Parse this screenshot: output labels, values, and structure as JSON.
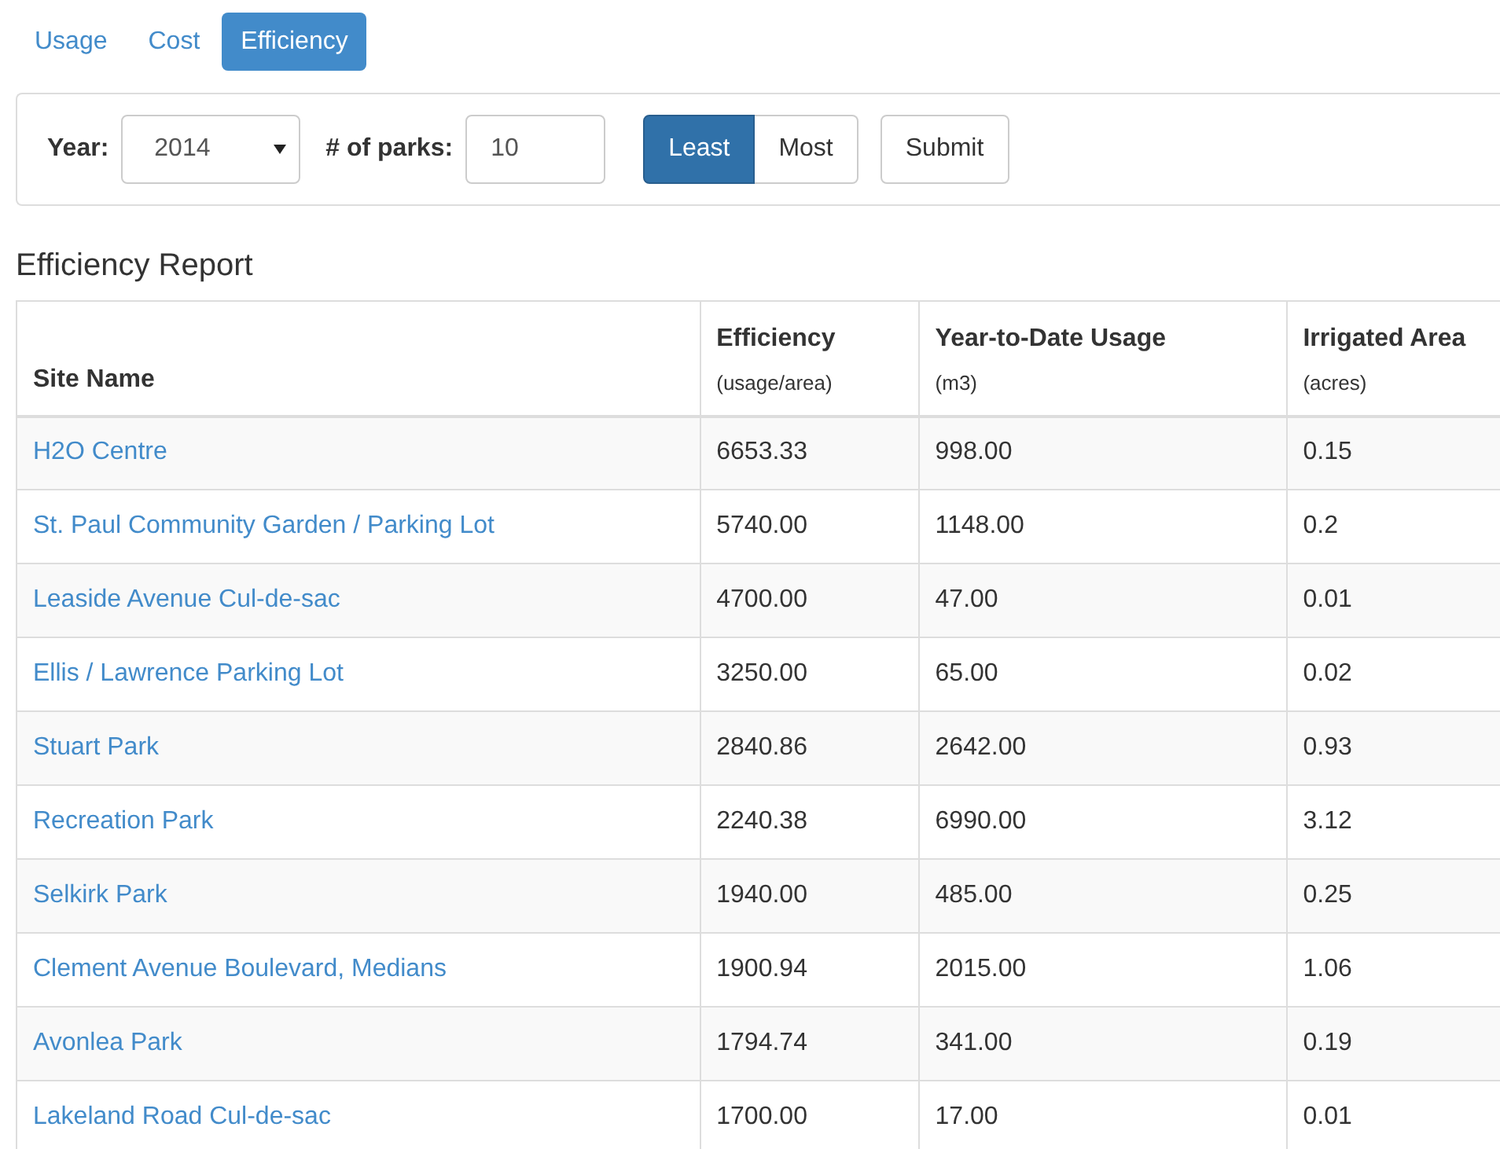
{
  "tabs": [
    {
      "label": "Usage",
      "selected": false
    },
    {
      "label": "Cost",
      "selected": false
    },
    {
      "label": "Efficiency",
      "selected": true
    }
  ],
  "filters": {
    "year_label": "Year:",
    "year": "2014",
    "parks_label": "# of parks:",
    "parks": "10",
    "order": [
      {
        "label": "Least",
        "selected": true
      },
      {
        "label": "Most",
        "selected": false
      }
    ],
    "submit": "Submit"
  },
  "report_title": "Efficiency Report",
  "table": {
    "columns": [
      {
        "label": "Site Name"
      },
      {
        "label": "Efficiency",
        "unit": "(usage/area)"
      },
      {
        "label": "Year-to-Date Usage",
        "unit": "(m3)"
      },
      {
        "label": "Irrigated Area",
        "unit": "(acres)"
      }
    ],
    "rows": [
      [
        "H2O Centre",
        "6653.33",
        "998.00",
        "0.15"
      ],
      [
        "St. Paul Community Garden / Parking Lot",
        "5740.00",
        "1148.00",
        "0.2"
      ],
      [
        "Leaside Avenue Cul-de-sac",
        "4700.00",
        "47.00",
        "0.01"
      ],
      [
        "Ellis / Lawrence Parking Lot",
        "3250.00",
        "65.00",
        "0.02"
      ],
      [
        "Stuart Park",
        "2840.86",
        "2642.00",
        "0.93"
      ],
      [
        "Recreation Park",
        "2240.38",
        "6990.00",
        "3.12"
      ],
      [
        "Selkirk Park",
        "1940.00",
        "485.00",
        "0.25"
      ],
      [
        "Clement Avenue Boulevard, Medians",
        "1900.94",
        "2015.00",
        "1.06"
      ],
      [
        "Avonlea Park",
        "1794.74",
        "341.00",
        "0.19"
      ],
      [
        "Lakeland Road Cul-de-sac",
        "1700.00",
        "17.00",
        "0.01"
      ]
    ]
  }
}
